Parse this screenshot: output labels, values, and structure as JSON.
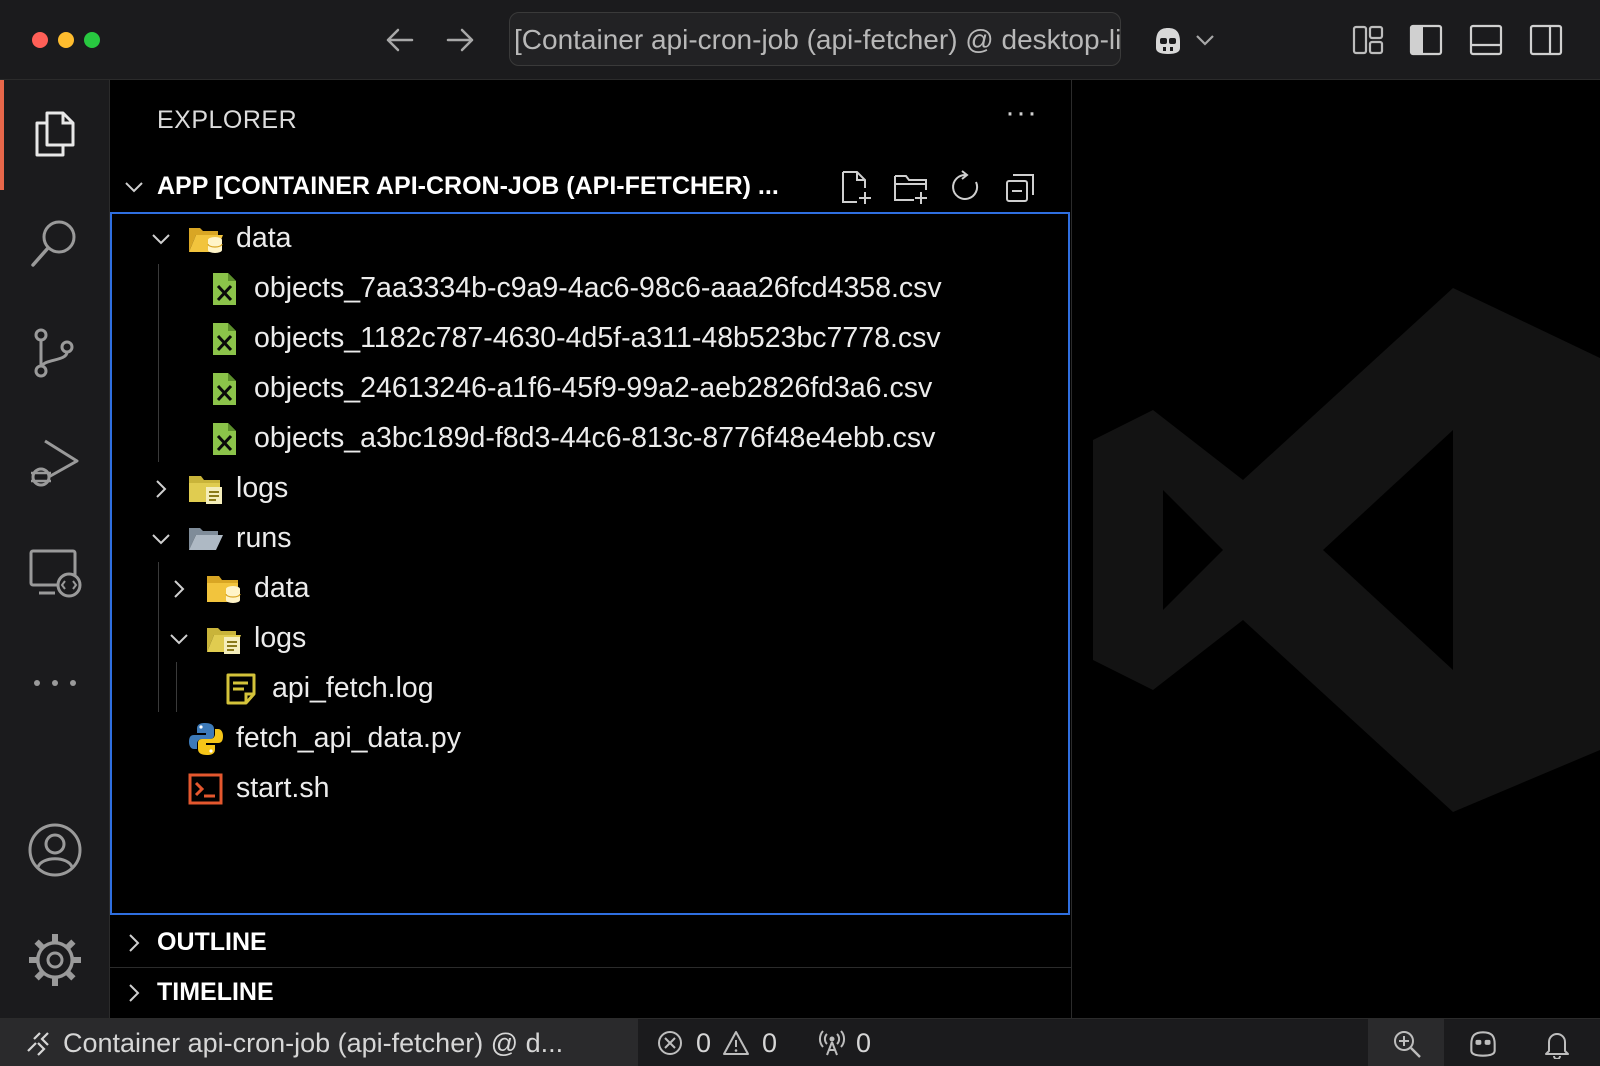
{
  "window": {
    "command_center": "[Container api-cron-job (api-fetcher) @ desktop-linux]"
  },
  "sidebar": {
    "title": "EXPLORER",
    "more": "···",
    "workspace_title": "APP [CONTAINER API-CRON-JOB (API-FETCHER) ...",
    "tree": [
      {
        "name": "data",
        "type": "folder-data",
        "expanded": true
      },
      {
        "name": "objects_7aa3334b-c9a9-4ac6-98c6-aaa26fcd4358.csv",
        "type": "csv"
      },
      {
        "name": "objects_1182c787-4630-4d5f-a311-48b523bc7778.csv",
        "type": "csv"
      },
      {
        "name": "objects_24613246-a1f6-45f9-99a2-aeb2826fd3a6.csv",
        "type": "csv"
      },
      {
        "name": "objects_a3bc189d-f8d3-44c6-813c-8776f48e4ebb.csv",
        "type": "csv"
      },
      {
        "name": "logs",
        "type": "folder-logs",
        "expanded": false
      },
      {
        "name": "runs",
        "type": "folder",
        "expanded": true
      },
      {
        "name": "data",
        "type": "folder-data",
        "expanded": false
      },
      {
        "name": "logs",
        "type": "folder-logs",
        "expanded": true
      },
      {
        "name": "api_fetch.log",
        "type": "log"
      },
      {
        "name": "fetch_api_data.py",
        "type": "python"
      },
      {
        "name": "start.sh",
        "type": "shell"
      }
    ],
    "outline": "OUTLINE",
    "timeline": "TIMELINE"
  },
  "statusbar": {
    "remote": "Container api-cron-job (api-fetcher) @ d...",
    "errors": "0",
    "warnings": "0",
    "ports": "0"
  },
  "colors": {
    "accent": "#2f6fe0",
    "activity_indicator": "#e8674a",
    "csv_green": "#8bc34a",
    "folder_yellow": "#f2c43d",
    "shell_orange": "#e4572e"
  }
}
